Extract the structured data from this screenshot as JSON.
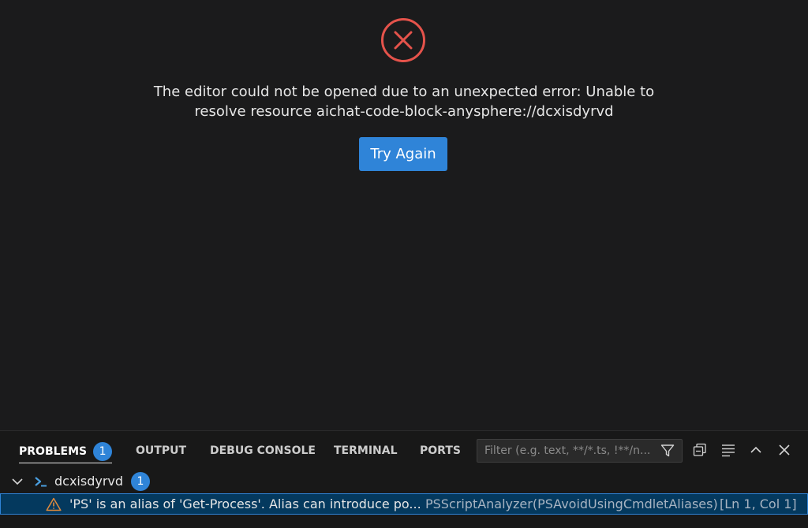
{
  "editor": {
    "error_icon": "error-circle-x-icon",
    "error_message_line1": "The editor could not be opened due to an unexpected error: Unable to",
    "error_message_line2": "resolve resource aichat-code-block-anysphere://dcxisdyrvd",
    "try_again_label": "Try Again",
    "error_color": "#e5534b",
    "accent": "#2f84d8"
  },
  "panel": {
    "tabs": [
      {
        "label": "PROBLEMS",
        "badge": "1",
        "active": true
      },
      {
        "label": "OUTPUT"
      },
      {
        "label": "DEBUG CONSOLE"
      },
      {
        "label": "TERMINAL"
      },
      {
        "label": "PORTS"
      }
    ],
    "filter": {
      "placeholder": "Filter (e.g. text, **/*.ts, !**/n...",
      "icon": "filter-icon"
    },
    "actions": [
      "collapse-all-icon",
      "view-as-list-icon",
      "chevron-up-icon",
      "close-icon"
    ],
    "tree": {
      "file_name": "dcxisdyrvd",
      "file_icon": "powershell-icon",
      "count": "1",
      "problem": {
        "severity_icon": "warning-icon",
        "message": "'PS' is an alias of 'Get-Process'. Alias can introduce po...",
        "source": "PSScriptAnalyzer(PSAvoidUsingCmdletAliases)",
        "location": "[Ln 1, Col 1]"
      }
    }
  }
}
